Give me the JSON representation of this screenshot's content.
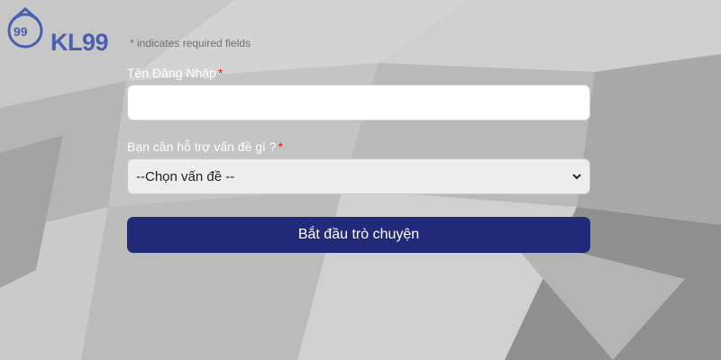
{
  "brand": {
    "logo_text": "KL99",
    "logo_icon": "kl99-emblem-icon"
  },
  "form": {
    "required_note": "* indicates required fields",
    "username_label": "Tên Đăng Nhập",
    "username_value": "",
    "topic_label": "Bạn cần hỗ trợ vấn đề gì ?",
    "topic_selected": "--Chọn vấn đề --",
    "required_marker": "*",
    "submit_label": "Bắt đầu trò chuyện"
  },
  "colors": {
    "button_bg": "#212a78",
    "required_star": "#d9261c",
    "logo": "#4a5fb0"
  }
}
